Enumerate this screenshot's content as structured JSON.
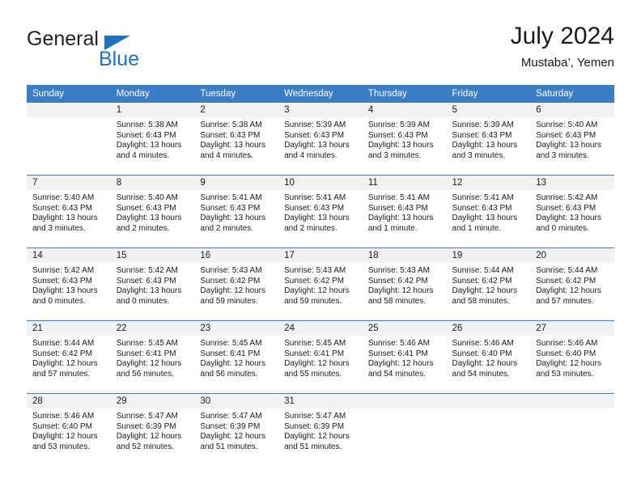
{
  "brand": {
    "name_part1": "General",
    "name_part2": "Blue",
    "flag_icon": "blue-triangle-flag",
    "colors": {
      "dark": "#231f20",
      "blue": "#1f72bd"
    }
  },
  "header": {
    "title": "July 2024",
    "subtitle": "Mustaba’, Yemen"
  },
  "theme": {
    "header_blue": "#3b7dc4",
    "daynum_band": "#f2f2f2",
    "text": "#1a1a1a"
  },
  "weekday_headers": [
    "Sunday",
    "Monday",
    "Tuesday",
    "Wednesday",
    "Thursday",
    "Friday",
    "Saturday"
  ],
  "weeks": [
    [
      {
        "day": "",
        "lines": []
      },
      {
        "day": "1",
        "lines": [
          "Sunrise: 5:38 AM",
          "Sunset: 6:43 PM",
          "Daylight: 13 hours",
          "and 4 minutes."
        ]
      },
      {
        "day": "2",
        "lines": [
          "Sunrise: 5:38 AM",
          "Sunset: 6:43 PM",
          "Daylight: 13 hours",
          "and 4 minutes."
        ]
      },
      {
        "day": "3",
        "lines": [
          "Sunrise: 5:39 AM",
          "Sunset: 6:43 PM",
          "Daylight: 13 hours",
          "and 4 minutes."
        ]
      },
      {
        "day": "4",
        "lines": [
          "Sunrise: 5:39 AM",
          "Sunset: 6:43 PM",
          "Daylight: 13 hours",
          "and 3 minutes."
        ]
      },
      {
        "day": "5",
        "lines": [
          "Sunrise: 5:39 AM",
          "Sunset: 6:43 PM",
          "Daylight: 13 hours",
          "and 3 minutes."
        ]
      },
      {
        "day": "6",
        "lines": [
          "Sunrise: 5:40 AM",
          "Sunset: 6:43 PM",
          "Daylight: 13 hours",
          "and 3 minutes."
        ]
      }
    ],
    [
      {
        "day": "7",
        "lines": [
          "Sunrise: 5:40 AM",
          "Sunset: 6:43 PM",
          "Daylight: 13 hours",
          "and 3 minutes."
        ]
      },
      {
        "day": "8",
        "lines": [
          "Sunrise: 5:40 AM",
          "Sunset: 6:43 PM",
          "Daylight: 13 hours",
          "and 2 minutes."
        ]
      },
      {
        "day": "9",
        "lines": [
          "Sunrise: 5:41 AM",
          "Sunset: 6:43 PM",
          "Daylight: 13 hours",
          "and 2 minutes."
        ]
      },
      {
        "day": "10",
        "lines": [
          "Sunrise: 5:41 AM",
          "Sunset: 6:43 PM",
          "Daylight: 13 hours",
          "and 2 minutes."
        ]
      },
      {
        "day": "11",
        "lines": [
          "Sunrise: 5:41 AM",
          "Sunset: 6:43 PM",
          "Daylight: 13 hours",
          "and 1 minute."
        ]
      },
      {
        "day": "12",
        "lines": [
          "Sunrise: 5:41 AM",
          "Sunset: 6:43 PM",
          "Daylight: 13 hours",
          "and 1 minute."
        ]
      },
      {
        "day": "13",
        "lines": [
          "Sunrise: 5:42 AM",
          "Sunset: 6:43 PM",
          "Daylight: 13 hours",
          "and 0 minutes."
        ]
      }
    ],
    [
      {
        "day": "14",
        "lines": [
          "Sunrise: 5:42 AM",
          "Sunset: 6:43 PM",
          "Daylight: 13 hours",
          "and 0 minutes."
        ]
      },
      {
        "day": "15",
        "lines": [
          "Sunrise: 5:42 AM",
          "Sunset: 6:43 PM",
          "Daylight: 13 hours",
          "and 0 minutes."
        ]
      },
      {
        "day": "16",
        "lines": [
          "Sunrise: 5:43 AM",
          "Sunset: 6:42 PM",
          "Daylight: 12 hours",
          "and 59 minutes."
        ]
      },
      {
        "day": "17",
        "lines": [
          "Sunrise: 5:43 AM",
          "Sunset: 6:42 PM",
          "Daylight: 12 hours",
          "and 59 minutes."
        ]
      },
      {
        "day": "18",
        "lines": [
          "Sunrise: 5:43 AM",
          "Sunset: 6:42 PM",
          "Daylight: 12 hours",
          "and 58 minutes."
        ]
      },
      {
        "day": "19",
        "lines": [
          "Sunrise: 5:44 AM",
          "Sunset: 6:42 PM",
          "Daylight: 12 hours",
          "and 58 minutes."
        ]
      },
      {
        "day": "20",
        "lines": [
          "Sunrise: 5:44 AM",
          "Sunset: 6:42 PM",
          "Daylight: 12 hours",
          "and 57 minutes."
        ]
      }
    ],
    [
      {
        "day": "21",
        "lines": [
          "Sunrise: 5:44 AM",
          "Sunset: 6:42 PM",
          "Daylight: 12 hours",
          "and 57 minutes."
        ]
      },
      {
        "day": "22",
        "lines": [
          "Sunrise: 5:45 AM",
          "Sunset: 6:41 PM",
          "Daylight: 12 hours",
          "and 56 minutes."
        ]
      },
      {
        "day": "23",
        "lines": [
          "Sunrise: 5:45 AM",
          "Sunset: 6:41 PM",
          "Daylight: 12 hours",
          "and 56 minutes."
        ]
      },
      {
        "day": "24",
        "lines": [
          "Sunrise: 5:45 AM",
          "Sunset: 6:41 PM",
          "Daylight: 12 hours",
          "and 55 minutes."
        ]
      },
      {
        "day": "25",
        "lines": [
          "Sunrise: 5:46 AM",
          "Sunset: 6:41 PM",
          "Daylight: 12 hours",
          "and 54 minutes."
        ]
      },
      {
        "day": "26",
        "lines": [
          "Sunrise: 5:46 AM",
          "Sunset: 6:40 PM",
          "Daylight: 12 hours",
          "and 54 minutes."
        ]
      },
      {
        "day": "27",
        "lines": [
          "Sunrise: 5:46 AM",
          "Sunset: 6:40 PM",
          "Daylight: 12 hours",
          "and 53 minutes."
        ]
      }
    ],
    [
      {
        "day": "28",
        "lines": [
          "Sunrise: 5:46 AM",
          "Sunset: 6:40 PM",
          "Daylight: 12 hours",
          "and 53 minutes."
        ]
      },
      {
        "day": "29",
        "lines": [
          "Sunrise: 5:47 AM",
          "Sunset: 6:39 PM",
          "Daylight: 12 hours",
          "and 52 minutes."
        ]
      },
      {
        "day": "30",
        "lines": [
          "Sunrise: 5:47 AM",
          "Sunset: 6:39 PM",
          "Daylight: 12 hours",
          "and 51 minutes."
        ]
      },
      {
        "day": "31",
        "lines": [
          "Sunrise: 5:47 AM",
          "Sunset: 6:39 PM",
          "Daylight: 12 hours",
          "and 51 minutes."
        ]
      },
      {
        "day": "",
        "lines": []
      },
      {
        "day": "",
        "lines": []
      },
      {
        "day": "",
        "lines": []
      }
    ]
  ]
}
